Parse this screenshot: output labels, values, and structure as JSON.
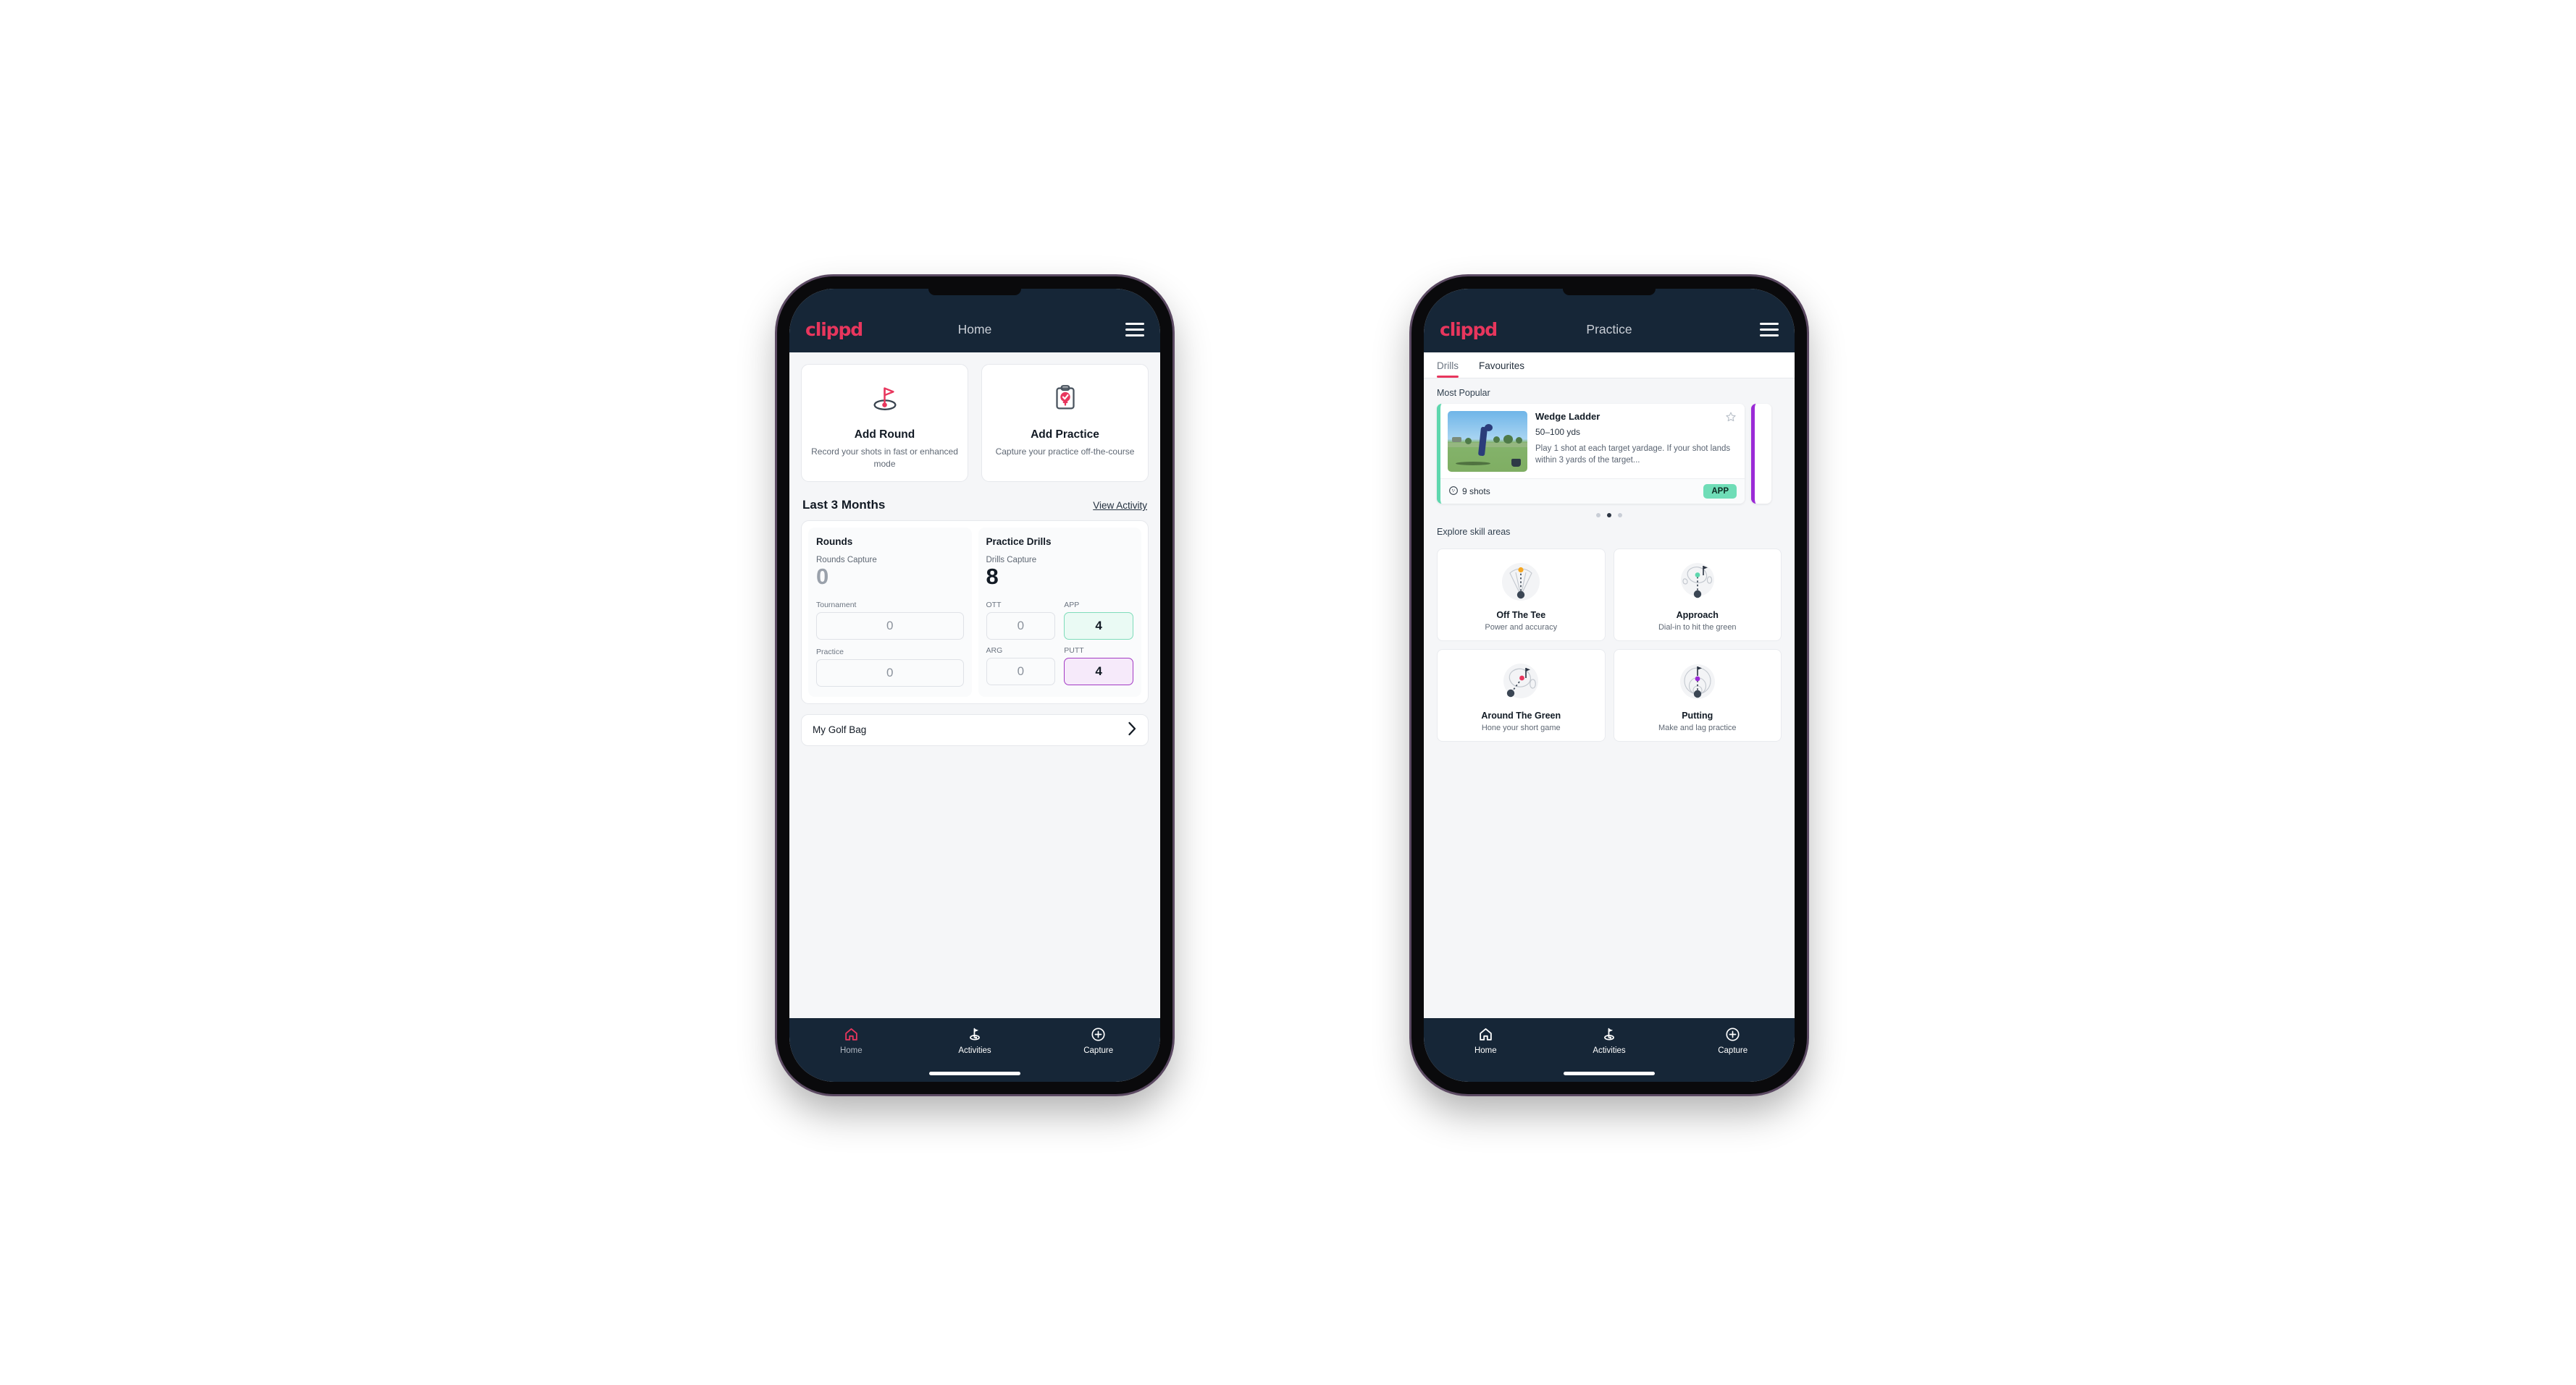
{
  "theme": {
    "brand_pink": "#e8365d",
    "navy": "#162637",
    "app_bg": "#f5f6f8",
    "accent_teal": "#6fddb7",
    "accent_purple": "#9b2ad6"
  },
  "phone1": {
    "appbar": {
      "logo": "clippd",
      "title": "Home",
      "menu_icon": "hamburger-icon"
    },
    "quick_actions": [
      {
        "icon": "golf-flag-icon",
        "title": "Add Round",
        "subtitle": "Record your shots in fast or enhanced mode"
      },
      {
        "icon": "clipboard-check-icon",
        "title": "Add Practice",
        "subtitle": "Capture your practice off-the-course"
      }
    ],
    "section": {
      "title": "Last 3 Months",
      "link": "View Activity"
    },
    "rounds": {
      "title": "Rounds",
      "capture_label": "Rounds Capture",
      "capture_value": "0",
      "fields": [
        {
          "label": "Tournament",
          "value": "0"
        },
        {
          "label": "Practice",
          "value": "0"
        }
      ]
    },
    "practice_drills": {
      "title": "Practice Drills",
      "capture_label": "Drills Capture",
      "capture_value": "8",
      "fields": [
        {
          "label": "OTT",
          "value": "0",
          "accent": "none"
        },
        {
          "label": "APP",
          "value": "4",
          "accent": "teal"
        },
        {
          "label": "ARG",
          "value": "0",
          "accent": "none"
        },
        {
          "label": "PUTT",
          "value": "4",
          "accent": "purple"
        }
      ]
    },
    "golf_bag": {
      "label": "My Golf Bag",
      "chevron": "chevron-right-icon"
    },
    "bottom_nav": [
      {
        "icon": "home-icon",
        "label": "Home",
        "active": true
      },
      {
        "icon": "golf-flag-icon",
        "label": "Activities",
        "active": false
      },
      {
        "icon": "plus-circle-icon",
        "label": "Capture",
        "active": false
      }
    ]
  },
  "phone2": {
    "appbar": {
      "logo": "clippd",
      "title": "Practice",
      "menu_icon": "hamburger-icon"
    },
    "tabs": [
      {
        "label": "Drills",
        "active": true
      },
      {
        "label": "Favourites",
        "active": false
      }
    ],
    "most_popular": {
      "label": "Most Popular"
    },
    "drill_card": {
      "title": "Wedge Ladder",
      "yardage": "50–100 yds",
      "description": "Play 1 shot at each target yardage. If your shot lands within 3 yards of the target...",
      "shots": "9 shots",
      "shots_icon": "golf-ball-icon",
      "badge": "APP",
      "favourite_icon": "star-outline-icon",
      "thumbnail_alt": "golfer-hitting-wedge-photo"
    },
    "carousel_dots": {
      "count": 3,
      "active_index": 1
    },
    "explore": {
      "label": "Explore skill areas"
    },
    "skill_areas": [
      {
        "icon": "off-the-tee-icon",
        "title": "Off The Tee",
        "subtitle": "Power and accuracy"
      },
      {
        "icon": "approach-icon",
        "title": "Approach",
        "subtitle": "Dial-in to hit the green"
      },
      {
        "icon": "around-the-green-icon",
        "title": "Around The Green",
        "subtitle": "Hone your short game"
      },
      {
        "icon": "putting-icon",
        "title": "Putting",
        "subtitle": "Make and lag practice"
      }
    ],
    "bottom_nav": [
      {
        "icon": "home-icon",
        "label": "Home",
        "active": false
      },
      {
        "icon": "golf-flag-icon",
        "label": "Activities",
        "active": false
      },
      {
        "icon": "plus-circle-icon",
        "label": "Capture",
        "active": false
      }
    ]
  }
}
